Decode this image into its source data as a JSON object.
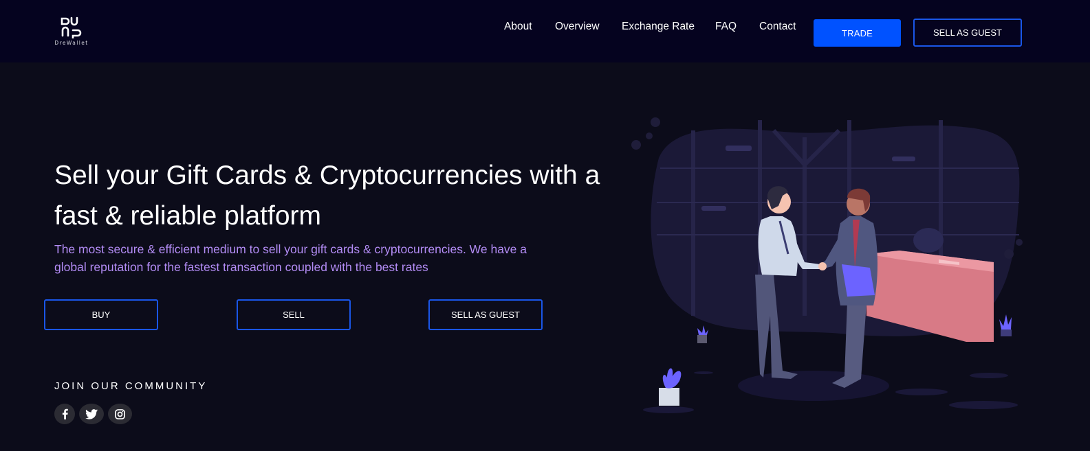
{
  "header": {
    "logo_text": "DreWallet",
    "nav": [
      "About",
      "Overview",
      "Exchange Rate",
      "FAQ",
      "Contact"
    ],
    "trade_label": "TRADE",
    "sell_guest_label": "SELL AS GUEST"
  },
  "hero": {
    "title": "Sell your Gift Cards & Cryptocurrencies with a fast & reliable platform",
    "subtitle": "The most secure & efficient medium to sell your gift cards & cryptocurrencies. We have a global reputation for the fastest transaction coupled with the best rates",
    "buttons": [
      "BUY",
      "SELL",
      "SELL AS GUEST"
    ]
  },
  "community": {
    "label": "JOIN OUR COMMUNITY",
    "socials": [
      "facebook-icon",
      "twitter-icon",
      "instagram-icon"
    ]
  },
  "colors": {
    "page_bg": "#0c0c1a",
    "header_bg": "#05031f",
    "primary": "#0052ff",
    "outline": "#1a56e8",
    "subtitle": "#b38cf5"
  }
}
